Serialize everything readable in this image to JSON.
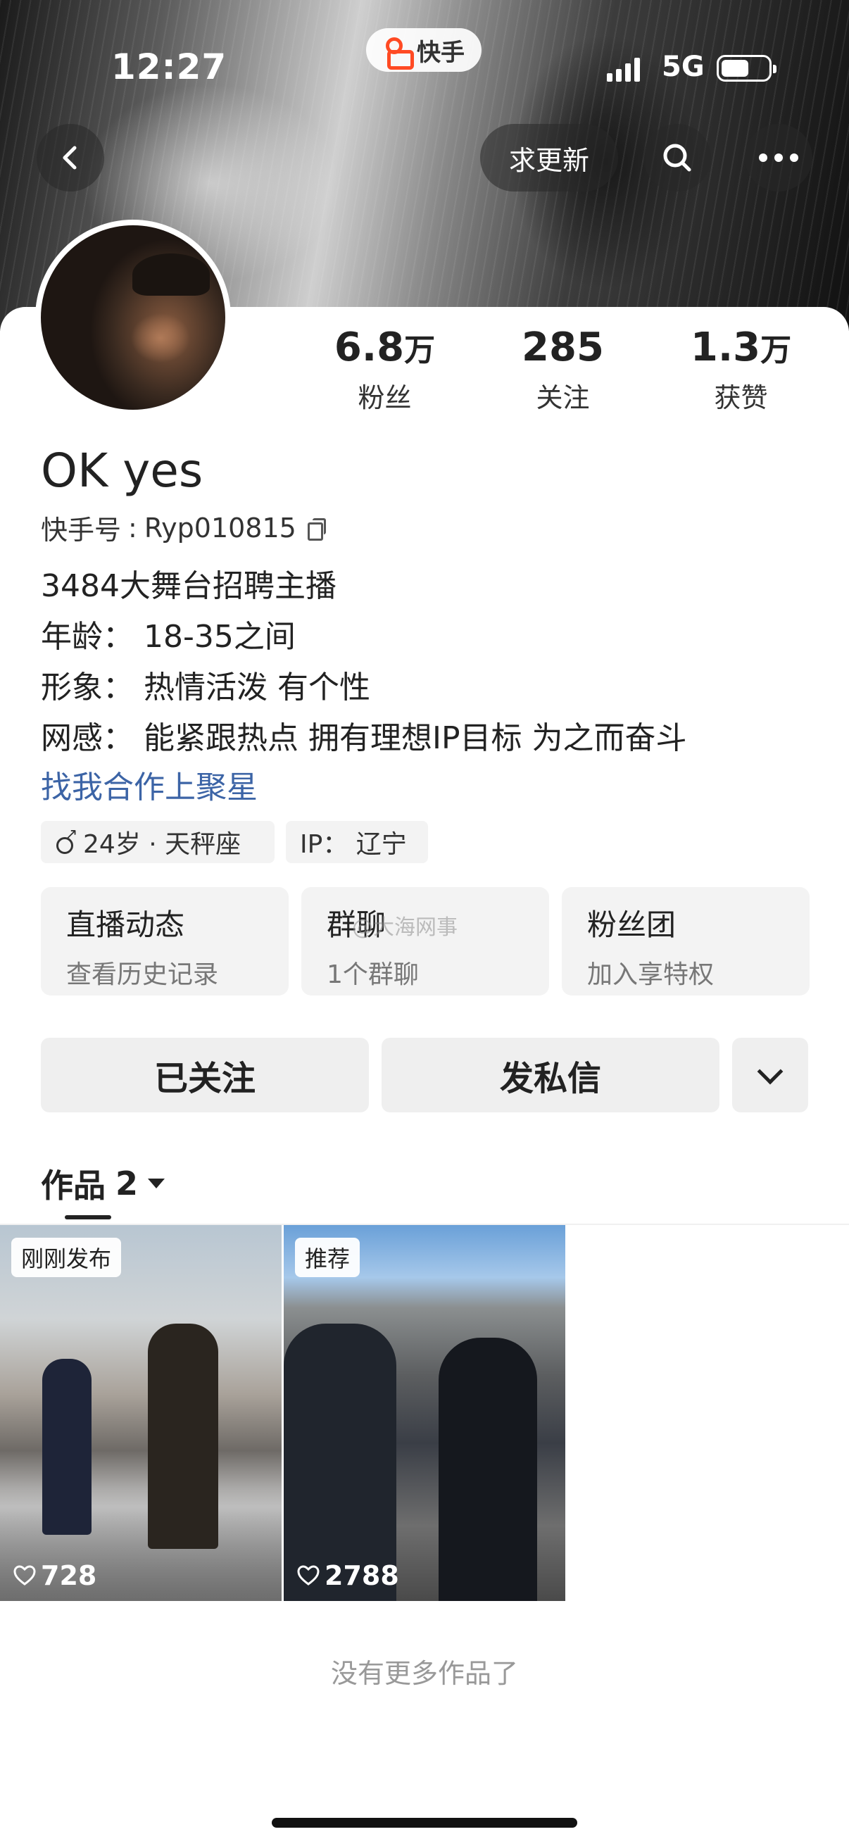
{
  "status_bar": {
    "time": "12:27",
    "network": "5G",
    "app_name": "快手"
  },
  "nav": {
    "update_label": "求更新"
  },
  "profile": {
    "nickname": "OK yes",
    "kuaishou_id_label": "快手号",
    "kuaishou_id": "Ryp010815",
    "stats": [
      {
        "value": "6.8",
        "unit": "万",
        "label": "粉丝"
      },
      {
        "value": "285",
        "unit": "",
        "label": "关注"
      },
      {
        "value": "1.3",
        "unit": "万",
        "label": "获赞"
      }
    ],
    "bio_lines": [
      "3484大舞台招聘主播",
      "年龄：  18-35之间",
      "形象：  热情活泼 有个性",
      "网感：  能紧跟热点 拥有理想IP目标 为之而奋斗"
    ],
    "link_text": "找我合作上聚星",
    "tags": {
      "age_zodiac": "24岁 · 天秤座",
      "ip": "IP：  辽宁"
    }
  },
  "cards": [
    {
      "title": "直播动态",
      "subtitle": "查看历史记录"
    },
    {
      "title": "群聊",
      "subtitle": "1个群聊"
    },
    {
      "title": "粉丝团",
      "subtitle": "加入享特权"
    }
  ],
  "watermark": "@大海网事",
  "actions": {
    "follow_label": "已关注",
    "message_label": "发私信"
  },
  "works": {
    "tab_label": "作品",
    "count": "2",
    "items": [
      {
        "badge": "刚刚发布",
        "likes": "728"
      },
      {
        "badge": "推荐",
        "likes": "2788"
      }
    ],
    "footer": "没有更多作品了"
  }
}
